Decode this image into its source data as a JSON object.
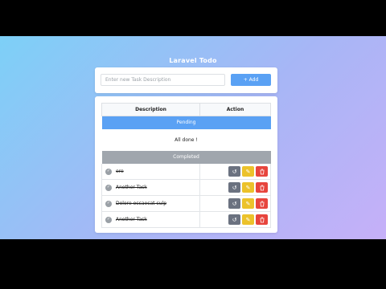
{
  "app": {
    "title": "Laravel Todo"
  },
  "add_form": {
    "placeholder": "Enter new Task Description",
    "button_label": "+ Add"
  },
  "table": {
    "headers": {
      "description": "Description",
      "action": "Action"
    },
    "sections": {
      "pending": "Pending",
      "completed": "Completed"
    },
    "pending_empty": "All done !",
    "completed_tasks": [
      {
        "text": "ere"
      },
      {
        "text": "Another Task"
      },
      {
        "text": "Dolore occaecat culp"
      },
      {
        "text": "Another Task"
      }
    ]
  },
  "icons": {
    "completed_check": "check-circle-icon",
    "undo": "undo-icon",
    "edit": "pencil-icon",
    "delete": "trash-icon"
  },
  "colors": {
    "accent": "#5aa1f4",
    "completed_bar": "#a0a6ad",
    "undo": "#6b7280",
    "edit": "#ecc22b",
    "delete": "#e7453d"
  }
}
